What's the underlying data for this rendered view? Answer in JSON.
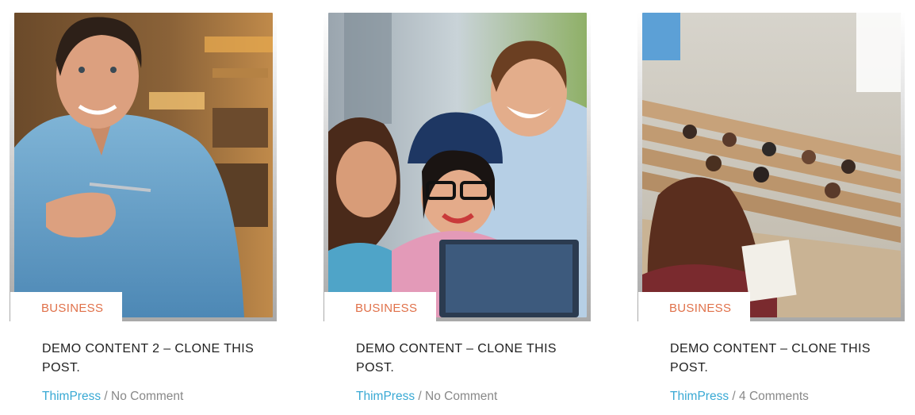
{
  "posts": [
    {
      "category": "BUSINESS",
      "title": "DEMO CONTENT 2 – CLONE THIS POST.",
      "author": "ThimPress",
      "separator": "/",
      "comments": "No Comment",
      "image": "man-with-pen-in-library"
    },
    {
      "category": "BUSINESS",
      "title": "DEMO CONTENT – CLONE THIS POST.",
      "author": "ThimPress",
      "separator": "/",
      "comments": "No Comment",
      "image": "students-laughing-at-laptop"
    },
    {
      "category": "BUSINESS",
      "title": "DEMO CONTENT – CLONE THIS POST.",
      "author": "ThimPress",
      "separator": "/",
      "comments": "4 Comments",
      "image": "lecture-hall-students"
    }
  ],
  "colors": {
    "category": "#e0714a",
    "author_link": "#39a9d4",
    "title": "#222222",
    "meta": "#888888"
  }
}
